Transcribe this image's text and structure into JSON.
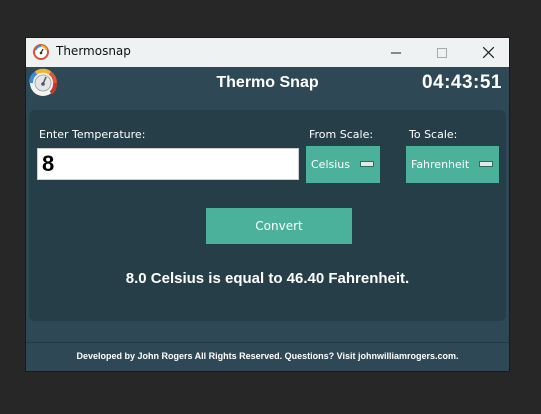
{
  "window": {
    "title": "Thermosnap"
  },
  "header": {
    "title": "Thermo Snap",
    "clock": "04:43:51"
  },
  "form": {
    "temp_label": "Enter Temperature:",
    "temp_value": "8",
    "from_label": "From Scale:",
    "from_value": "Celsius",
    "to_label": "To Scale:",
    "to_value": "Fahrenheit",
    "convert_label": "Convert"
  },
  "result": "8.0 Celsius is equal to 46.40 Fahrenheit.",
  "footer": "Developed by John Rogers All Rights Reserved. Questions? Visit johnwilliamrogers.com.",
  "colors": {
    "accent": "#4cb19a",
    "background": "#2f4855",
    "panel": "#263e48"
  },
  "icons": [
    "thermometer-gauge-icon",
    "minimize-icon",
    "maximize-icon",
    "close-icon",
    "dropdown-indicator-icon"
  ]
}
